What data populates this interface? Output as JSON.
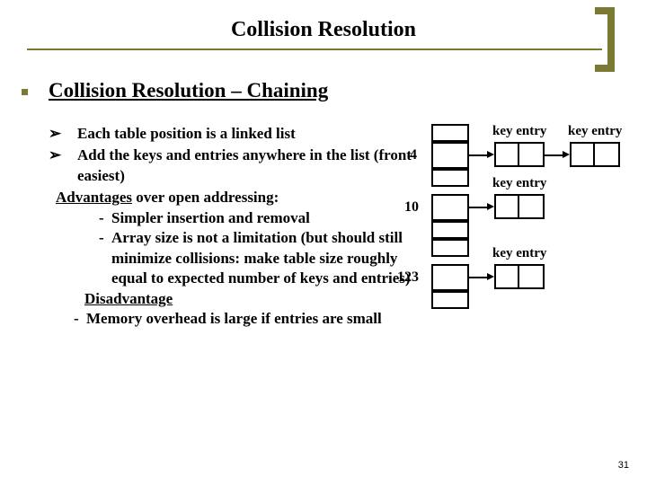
{
  "title": "Collision Resolution",
  "subtitle": "Collision Resolution – Chaining",
  "bullets": {
    "b1": "Each table position is a linked list",
    "b2": "Add the keys and entries anywhere in the list (front easiest)"
  },
  "advantages": {
    "heading_u": "Advantages",
    "heading_rest": " over open addressing:",
    "a1": "Simpler insertion and removal",
    "a2": "Array size is not a limitation (but should  still minimize collisions: make table size roughly equal to expected number of keys  and entries)"
  },
  "disadvantage": {
    "heading": "Disadvantage",
    "d1": "Memory overhead is large if entries are small"
  },
  "diagram": {
    "row1": {
      "index": "4",
      "labels": [
        "key entry",
        "key entry"
      ]
    },
    "row2": {
      "index": "10",
      "labels": [
        "key entry"
      ]
    },
    "row3": {
      "index": "123",
      "labels": [
        "key entry"
      ]
    }
  },
  "page": "31"
}
